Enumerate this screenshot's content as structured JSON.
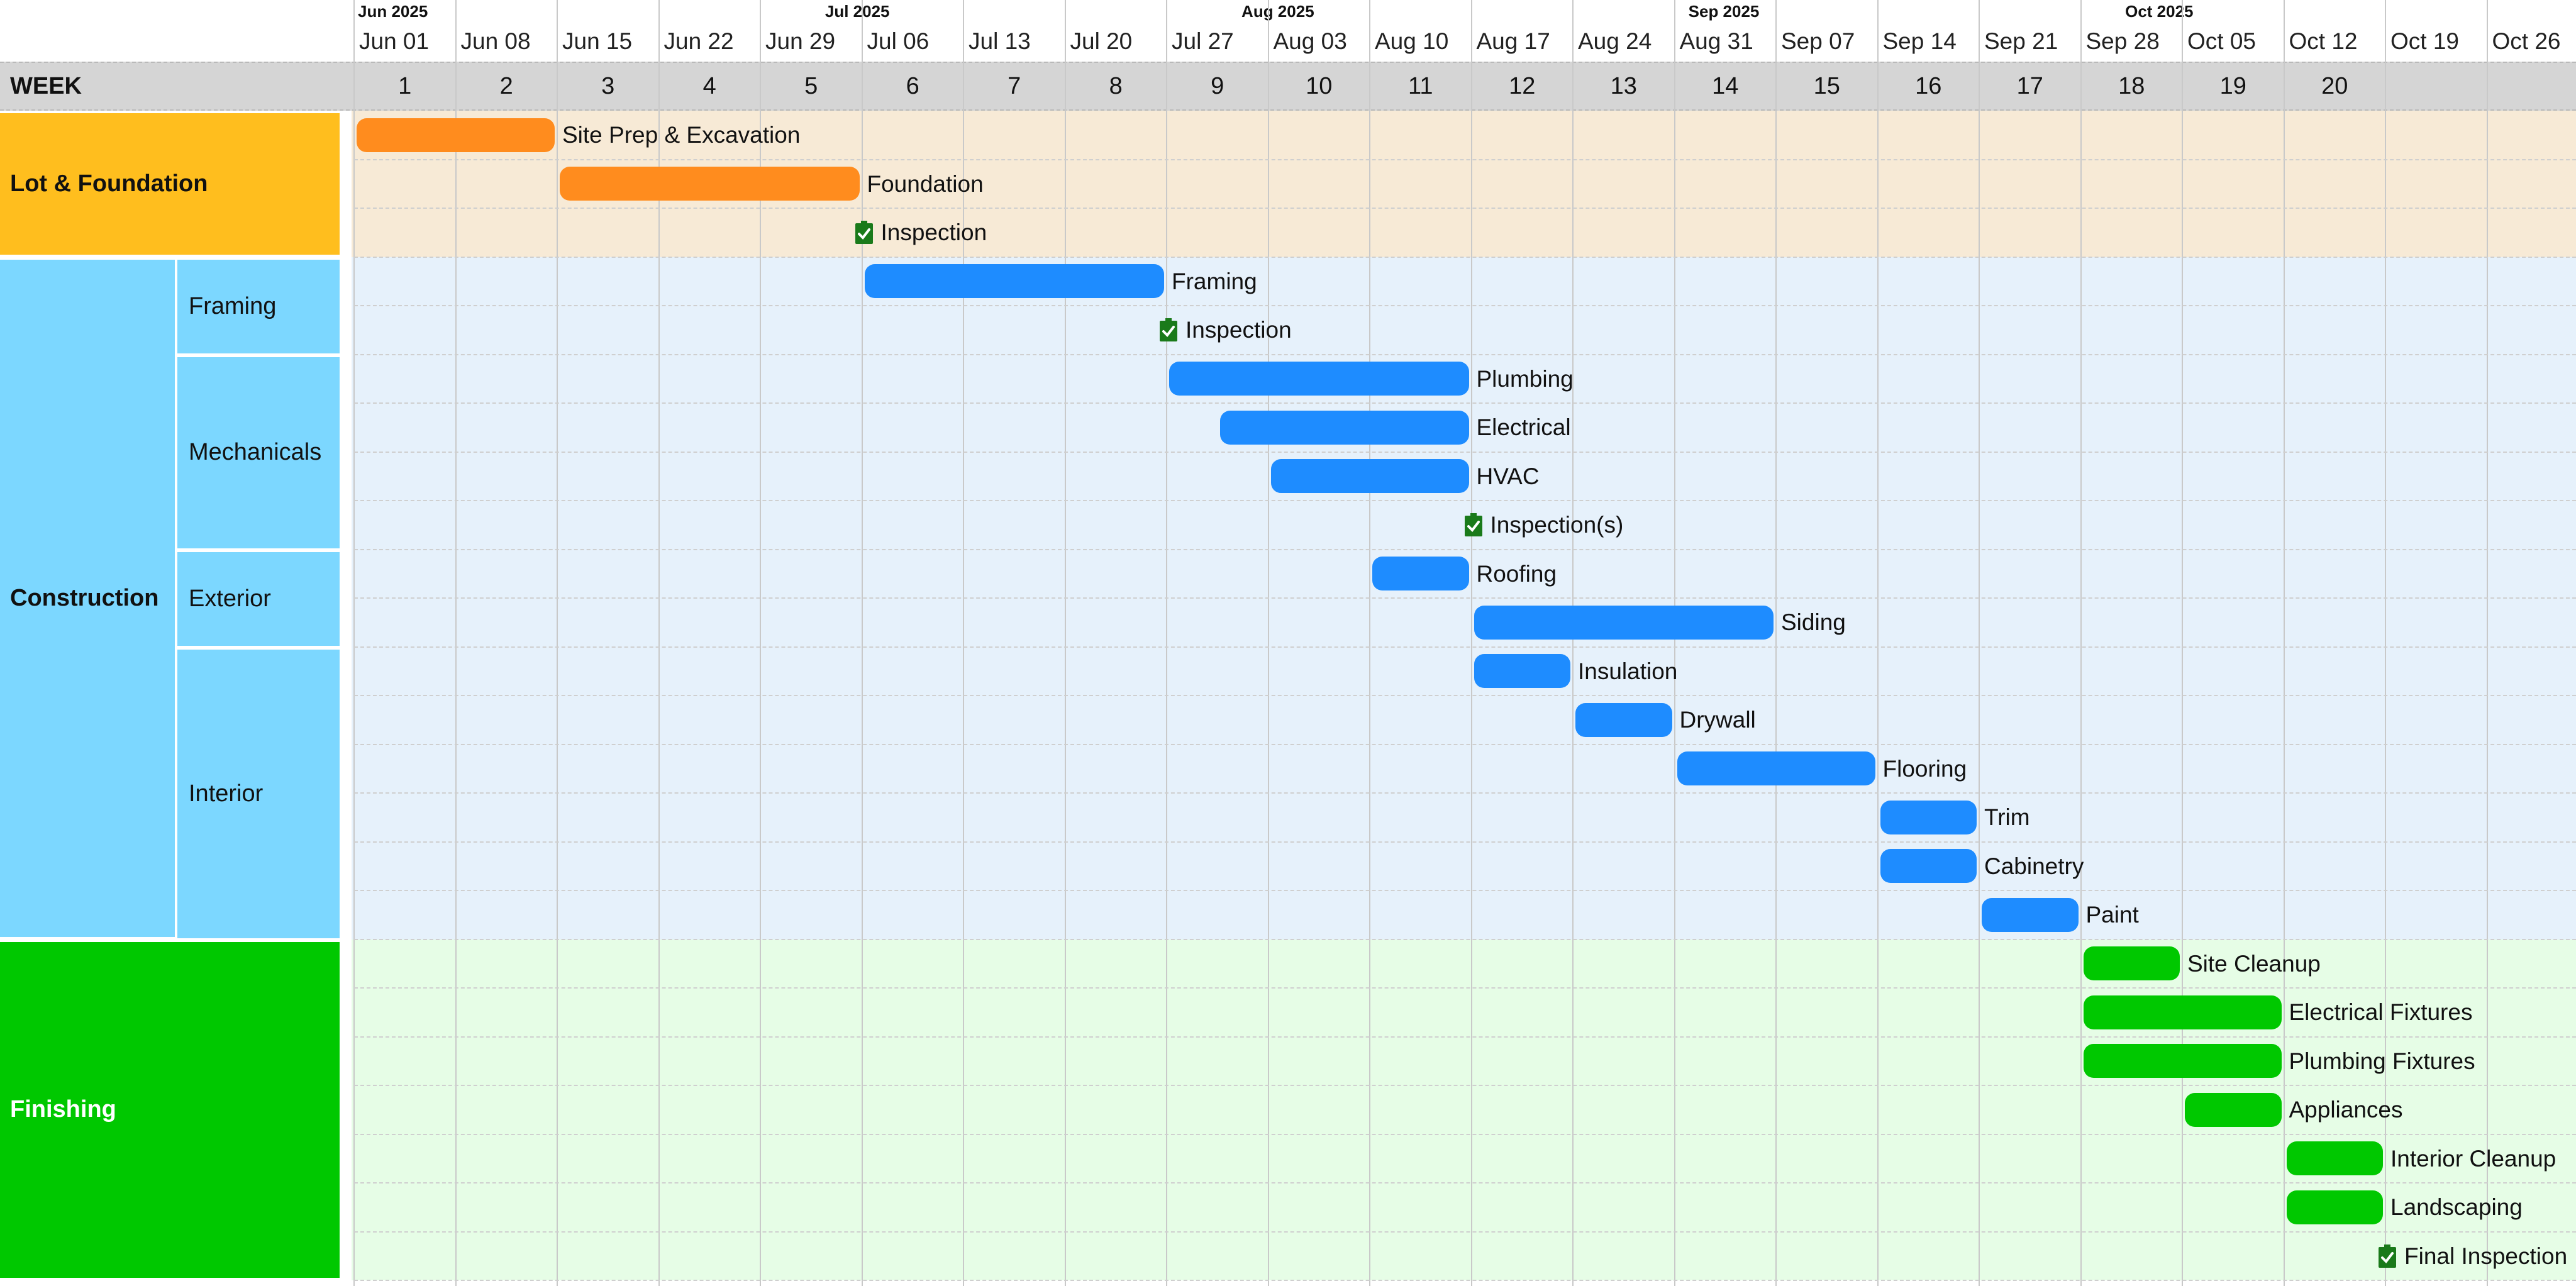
{
  "months": [
    {
      "label": "Jun 2025",
      "col": 0
    },
    {
      "label": "Jul 2025",
      "col": 4.6
    },
    {
      "label": "Aug 2025",
      "col": 8.7
    },
    {
      "label": "Sep 2025",
      "col": 13.1
    },
    {
      "label": "Oct 2025",
      "col": 17.4
    }
  ],
  "dates": [
    "Jun 01",
    "Jun 08",
    "Jun 15",
    "Jun 22",
    "Jun 29",
    "Jul 06",
    "Jul 13",
    "Jul 20",
    "Jul 27",
    "Aug 03",
    "Aug 10",
    "Aug 17",
    "Aug 24",
    "Aug 31",
    "Sep 07",
    "Sep 14",
    "Sep 21",
    "Sep 28",
    "Oct 05",
    "Oct 12",
    "Oct 19",
    "Oct 26"
  ],
  "week_header": {
    "title": "WEEK",
    "numbers": [
      "1",
      "2",
      "3",
      "4",
      "5",
      "6",
      "7",
      "8",
      "9",
      "10",
      "11",
      "12",
      "13",
      "14",
      "15",
      "16",
      "17",
      "18",
      "19",
      "20",
      "",
      ""
    ]
  },
  "groups": [
    {
      "label": "Lot & Foundation",
      "row_start": 0,
      "row_end": 3,
      "color": "#FFBE1E",
      "band_color": "#F7EAD6",
      "text_color": "#111111",
      "bold": true
    },
    {
      "label": "Construction",
      "row_start": 3,
      "row_end": 17,
      "color": "#7CD7FF",
      "band_color": "#E6F1FB",
      "text_color": "#111111",
      "bold": true
    },
    {
      "label": "Finishing",
      "row_start": 17,
      "row_end": 24,
      "color": "#00C800",
      "band_color": "#E6FDE6",
      "text_color": "#FFFFFF",
      "bold": true
    }
  ],
  "subgroups": [
    {
      "label": "Framing",
      "row_start": 3,
      "row_end": 5
    },
    {
      "label": "Mechanicals",
      "row_start": 5,
      "row_end": 9
    },
    {
      "label": "Exterior",
      "row_start": 9,
      "row_end": 11
    },
    {
      "label": "Interior",
      "row_start": 11,
      "row_end": 17
    }
  ],
  "colors": {
    "lot": "#FF8C1E",
    "construction": "#1E8CFF",
    "finishing": "#00C800",
    "milestone": "#1A7A1A",
    "grid": "#C9C9C9",
    "week_header_bg": "#D5D5D5"
  },
  "chart_data": {
    "type": "gantt",
    "x_unit": "week",
    "x_range": [
      "2025-06-01",
      "2025-11-02"
    ],
    "tasks": [
      {
        "label": "Site Prep & Excavation",
        "start_week": 1,
        "end_week": 2,
        "group": "lot",
        "milestone": false
      },
      {
        "label": "Foundation",
        "start_week": 3,
        "end_week": 5,
        "group": "lot",
        "milestone": false
      },
      {
        "label": "Inspection",
        "start_week": 6,
        "end_week": 6,
        "group": "lot",
        "milestone": true
      },
      {
        "label": "Framing",
        "start_week": 6,
        "end_week": 8,
        "group": "construction",
        "milestone": false
      },
      {
        "label": "Inspection",
        "start_week": 9,
        "end_week": 9,
        "group": "construction",
        "milestone": true
      },
      {
        "label": "Plumbing",
        "start_week": 9,
        "end_week": 11,
        "group": "construction",
        "milestone": false
      },
      {
        "label": "Electrical",
        "start_week": 9.5,
        "end_week": 11,
        "group": "construction",
        "milestone": false
      },
      {
        "label": "HVAC",
        "start_week": 10,
        "end_week": 11,
        "group": "construction",
        "milestone": false
      },
      {
        "label": "Inspection(s)",
        "start_week": 12,
        "end_week": 12,
        "group": "construction",
        "milestone": true
      },
      {
        "label": "Roofing",
        "start_week": 11,
        "end_week": 11,
        "group": "construction",
        "milestone": false
      },
      {
        "label": "Siding",
        "start_week": 12,
        "end_week": 14,
        "group": "construction",
        "milestone": false
      },
      {
        "label": "Insulation",
        "start_week": 12,
        "end_week": 12,
        "group": "construction",
        "milestone": false
      },
      {
        "label": "Drywall",
        "start_week": 13,
        "end_week": 13,
        "group": "construction",
        "milestone": false
      },
      {
        "label": "Flooring",
        "start_week": 14,
        "end_week": 15,
        "group": "construction",
        "milestone": false
      },
      {
        "label": "Trim",
        "start_week": 16,
        "end_week": 16,
        "group": "construction",
        "milestone": false
      },
      {
        "label": "Cabinetry",
        "start_week": 16,
        "end_week": 16,
        "group": "construction",
        "milestone": false
      },
      {
        "label": "Paint",
        "start_week": 17,
        "end_week": 17,
        "group": "construction",
        "milestone": false
      },
      {
        "label": "Site Cleanup",
        "start_week": 18,
        "end_week": 18,
        "group": "finishing",
        "milestone": false
      },
      {
        "label": "Electrical Fixtures",
        "start_week": 18,
        "end_week": 19,
        "group": "finishing",
        "milestone": false
      },
      {
        "label": "Plumbing Fixtures",
        "start_week": 18,
        "end_week": 19,
        "group": "finishing",
        "milestone": false
      },
      {
        "label": "Appliances",
        "start_week": 19,
        "end_week": 19,
        "group": "finishing",
        "milestone": false
      },
      {
        "label": "Interior Cleanup",
        "start_week": 20,
        "end_week": 20,
        "group": "finishing",
        "milestone": false
      },
      {
        "label": "Landscaping",
        "start_week": 20,
        "end_week": 20,
        "group": "finishing",
        "milestone": false
      },
      {
        "label": "Final Inspection",
        "start_week": 21,
        "end_week": 21,
        "group": "finishing",
        "milestone": true
      }
    ]
  }
}
